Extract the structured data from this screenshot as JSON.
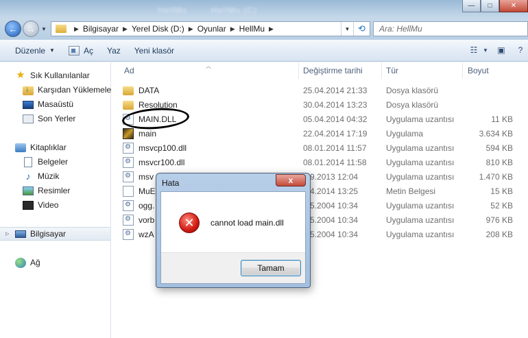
{
  "window": {
    "blurred_title": [
      "HellMu",
      "HellMu (C)"
    ],
    "minimize": "—",
    "maximize": "□",
    "close": "✕"
  },
  "address": {
    "crumbs": [
      "Bilgisayar",
      "Yerel Disk (D:)",
      "Oyunlar",
      "HellMu"
    ],
    "search_placeholder": "Ara: HellMu"
  },
  "toolbar": {
    "organize": "Düzenle",
    "open": "Aç",
    "burn": "Yaz",
    "new_folder": "Yeni klasör"
  },
  "sidebar": {
    "favorites_header": "Sık Kullanılanlar",
    "favorites": [
      "Karşıdan Yüklemeler",
      "Masaüstü",
      "Son Yerler"
    ],
    "libraries_header": "Kitaplıklar",
    "libraries": [
      "Belgeler",
      "Müzik",
      "Resimler",
      "Video"
    ],
    "computer": "Bilgisayar",
    "network": "Ağ"
  },
  "columns": {
    "name": "Ad",
    "date": "Değiştirme tarihi",
    "type": "Tür",
    "size": "Boyut"
  },
  "files": [
    {
      "name": "DATA",
      "date": "25.04.2014 21:33",
      "type": "Dosya klasörü",
      "size": "",
      "icon": "folder"
    },
    {
      "name": "Resolution",
      "date": "30.04.2014 13:23",
      "type": "Dosya klasörü",
      "size": "",
      "icon": "folder"
    },
    {
      "name": "MAIN.DLL",
      "date": "05.04.2014 04:32",
      "type": "Uygulama uzantısı",
      "size": "11 KB",
      "icon": "dll"
    },
    {
      "name": "main",
      "date": "22.04.2014 17:19",
      "type": "Uygulama",
      "size": "3.634 KB",
      "icon": "exe"
    },
    {
      "name": "msvcp100.dll",
      "date": "08.01.2014 11:57",
      "type": "Uygulama uzantısı",
      "size": "594 KB",
      "icon": "dll"
    },
    {
      "name": "msvcr100.dll",
      "date": "08.01.2014 11:58",
      "type": "Uygulama uzantısı",
      "size": "810 KB",
      "icon": "dll"
    },
    {
      "name": "msv",
      "date": ".09.2013 12:04",
      "type": "Uygulama uzantısı",
      "size": "1.470 KB",
      "icon": "dll"
    },
    {
      "name": "MuE",
      "date": ".04.2014 13:25",
      "type": "Metin Belgesi",
      "size": "15 KB",
      "icon": "txt"
    },
    {
      "name": "ogg.",
      "date": ".05.2004 10:34",
      "type": "Uygulama uzantısı",
      "size": "52 KB",
      "icon": "dll"
    },
    {
      "name": "vorb",
      "date": ".05.2004 10:34",
      "type": "Uygulama uzantısı",
      "size": "976 KB",
      "icon": "dll"
    },
    {
      "name": "wzA",
      "date": ".05.2004 10:34",
      "type": "Uygulama uzantısı",
      "size": "208 KB",
      "icon": "dll"
    }
  ],
  "dialog": {
    "title": "Hata",
    "close": "x",
    "message": "cannot load main.dll",
    "ok": "Tamam"
  }
}
